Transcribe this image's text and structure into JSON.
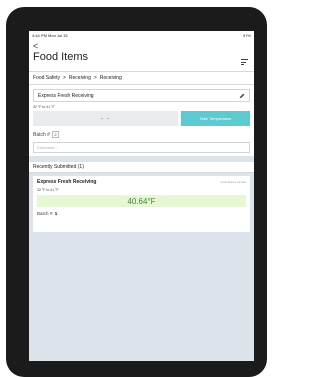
{
  "status_bar": {
    "time": "4:44 PM  Mon Jul 15",
    "battery": "97%"
  },
  "header": {
    "back_glyph": "<",
    "title": "Food Items"
  },
  "breadcrumb": {
    "items": [
      "Food Safety",
      "Receiving",
      "Receiving"
    ],
    "separator": ">"
  },
  "form": {
    "product_name": "Express Fresh Receiving",
    "range": "32 °F to 41 °F",
    "temperature_value": "- -",
    "take_temperature_label": "Take Temperature",
    "batch_label": "Batch #",
    "batch_value": "2",
    "comment_placeholder": "Comment..."
  },
  "recent": {
    "header": "Recently Submitted (1)",
    "items": [
      {
        "name": "Express Fresh Receiving",
        "time": "Less than a minute",
        "range": "32 °F to 41 °F",
        "reading": "40.64°F",
        "batch_label": "Batch #:",
        "batch_value": "1"
      }
    ]
  },
  "colors": {
    "accent": "#5ccad0",
    "reading_bg": "#e7f7d6",
    "reading_text": "#3b8a2c",
    "screen_bg": "#dde3ea"
  }
}
